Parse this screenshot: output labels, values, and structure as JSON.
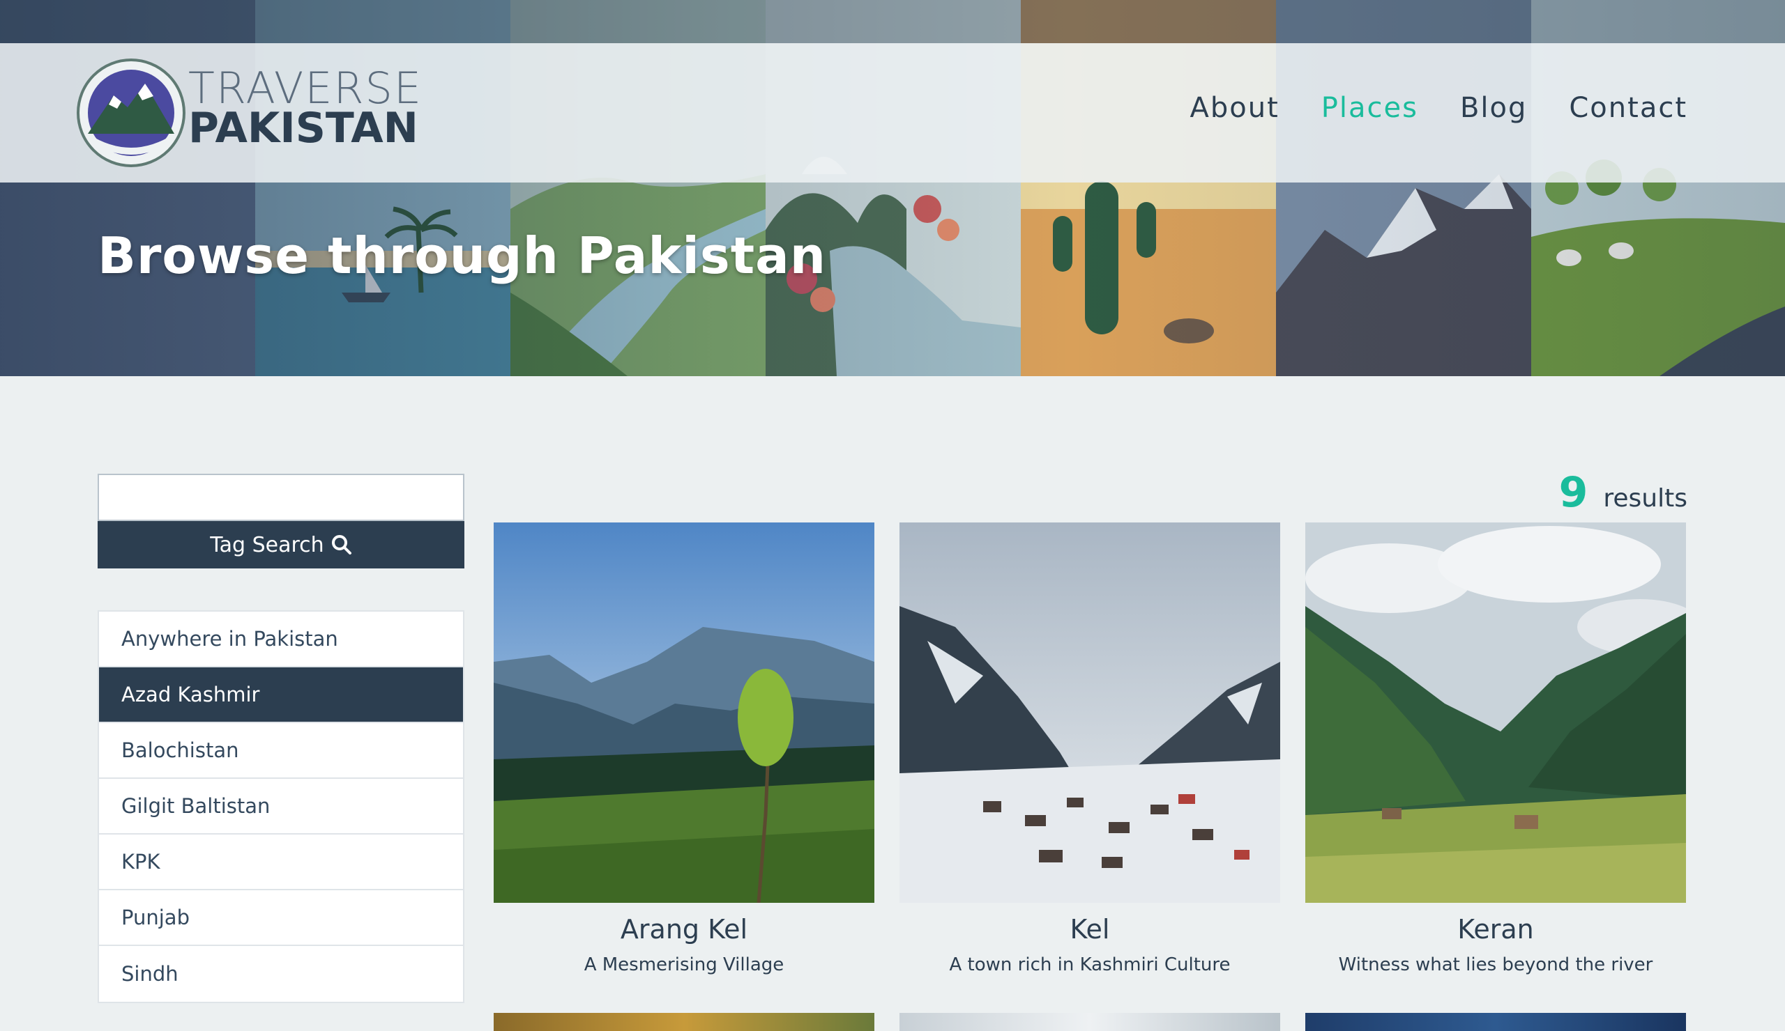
{
  "colors": {
    "accent": "#1abc9c",
    "dark": "#2c3e50",
    "background": "#ecf0f1"
  },
  "brand": {
    "line1": "TRAVERSE",
    "line2": "PAKISTAN",
    "logo_icon": "mountain-logo-icon"
  },
  "nav": {
    "items": [
      {
        "label": "About",
        "active": false
      },
      {
        "label": "Places",
        "active": true
      },
      {
        "label": "Blog",
        "active": false
      },
      {
        "label": "Contact",
        "active": false
      }
    ]
  },
  "hero": {
    "title": "Browse through Pakistan"
  },
  "search": {
    "value": "",
    "button_label": "Tag Search",
    "button_icon": "search-icon"
  },
  "filters": {
    "items": [
      {
        "label": "Anywhere in Pakistan",
        "selected": false
      },
      {
        "label": "Azad Kashmir",
        "selected": true
      },
      {
        "label": "Balochistan",
        "selected": false
      },
      {
        "label": "Gilgit Baltistan",
        "selected": false
      },
      {
        "label": "KPK",
        "selected": false
      },
      {
        "label": "Punjab",
        "selected": false
      },
      {
        "label": "Sindh",
        "selected": false
      }
    ]
  },
  "results": {
    "count": "9",
    "label": "results"
  },
  "places": [
    {
      "title": "Arang Kel",
      "subtitle": "A Mesmerising Village"
    },
    {
      "title": "Kel",
      "subtitle": "A town rich in Kashmiri Culture"
    },
    {
      "title": "Keran",
      "subtitle": "Witness what lies beyond the river"
    }
  ]
}
